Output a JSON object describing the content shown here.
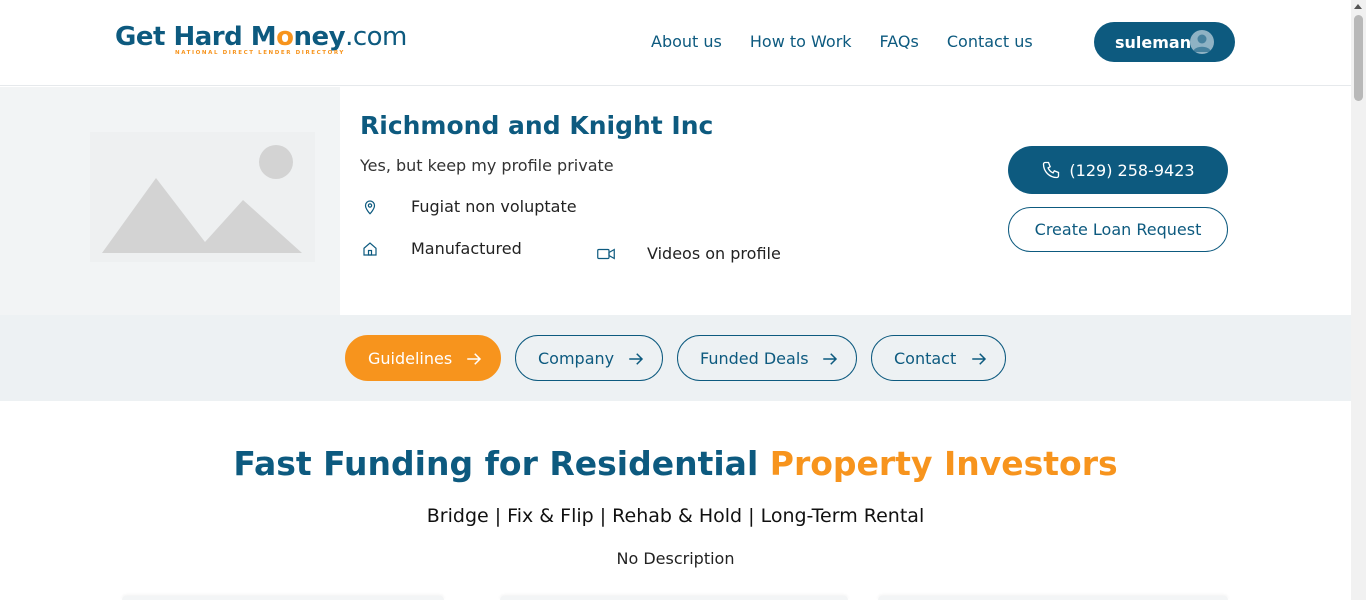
{
  "header": {
    "logo": {
      "text_main": "Get Hard M",
      "text_o": "o",
      "text_rest": "ney",
      "text_com": ".com",
      "tagline": "NATIONAL DIRECT LENDER DIRECTORY"
    },
    "nav": [
      "About us",
      "How to Work",
      "FAQs",
      "Contact us"
    ],
    "user": {
      "name": "suleman",
      "icon": "user-avatar-icon"
    }
  },
  "profile": {
    "name": "Richmond and Knight Inc",
    "subtitle": "Yes, but keep my profile private",
    "location": "Fugiat non voluptate",
    "property_type": "Manufactured",
    "videos": "Videos on profile",
    "phone": "(129) 258-9423",
    "loan_request": "Create Loan Request"
  },
  "tabs": [
    {
      "label": "Guidelines",
      "active": true
    },
    {
      "label": "Company",
      "active": false
    },
    {
      "label": "Funded Deals",
      "active": false
    },
    {
      "label": "Contact",
      "active": false
    }
  ],
  "main": {
    "headline_part1": "Fast Funding for Residential ",
    "headline_part2": "Property Investors",
    "loan_types": "Bridge | Fix & Flip | Rehab & Hold | Long-Term Rental",
    "description": "No Description"
  },
  "colors": {
    "primary": "#0d5a7f",
    "accent": "#f7941d",
    "band": "#edf1f3"
  }
}
